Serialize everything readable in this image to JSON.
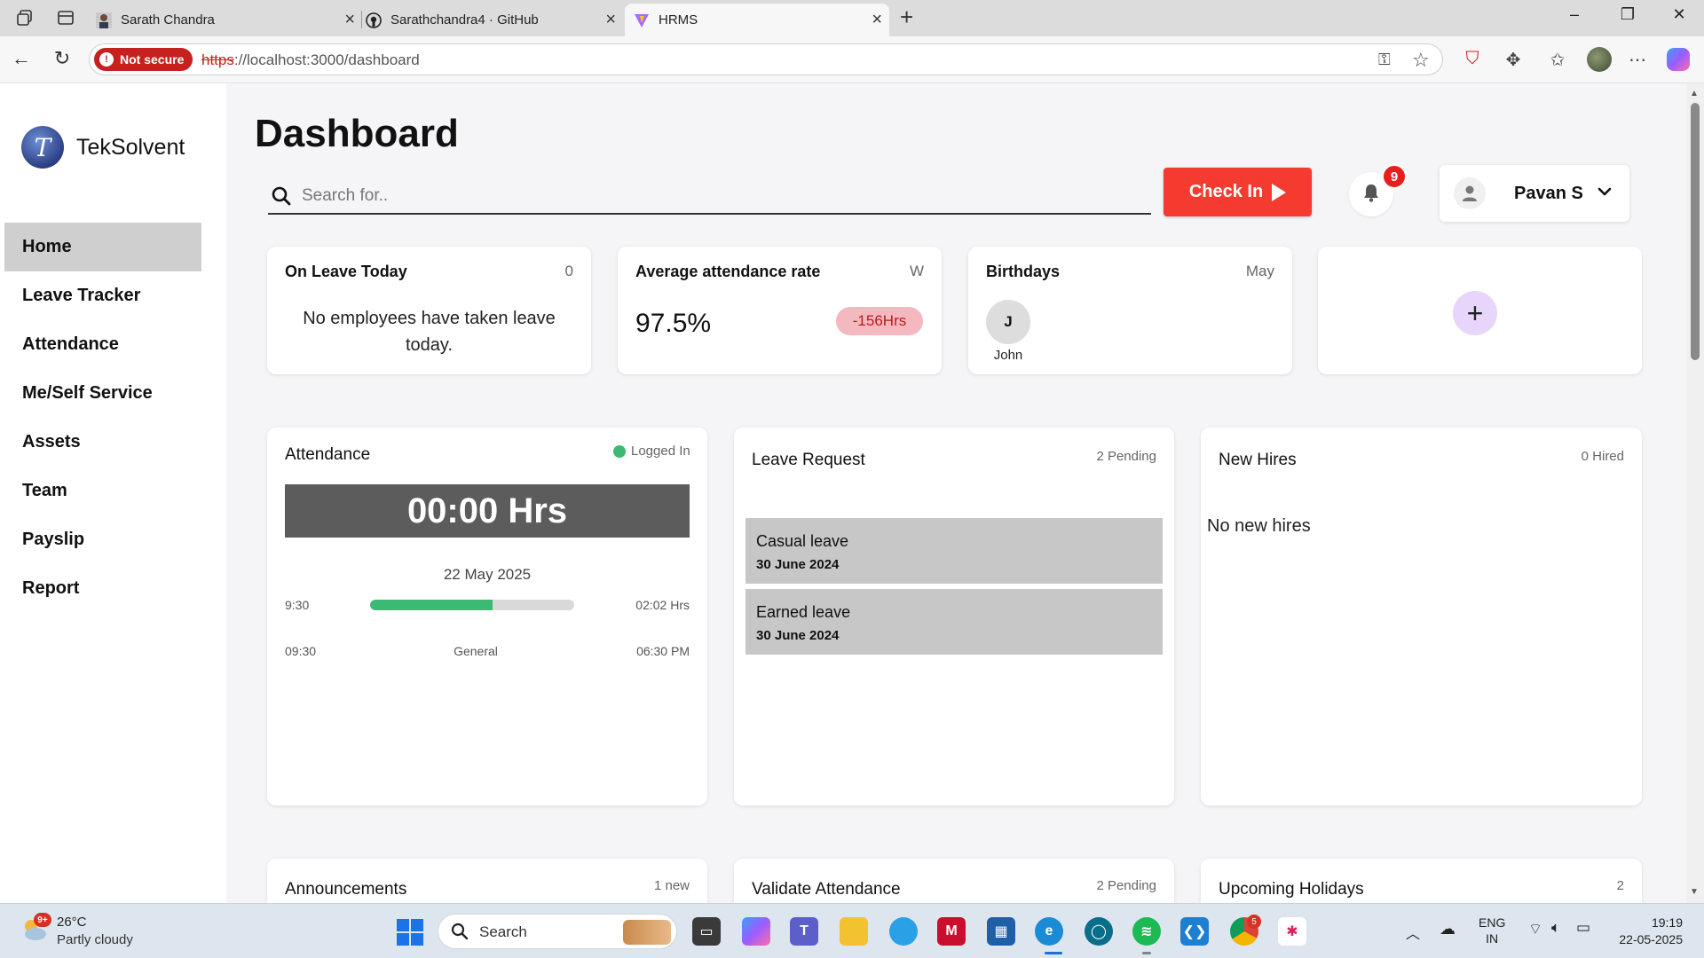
{
  "browser": {
    "tabs": [
      {
        "title": "Sarath Chandra"
      },
      {
        "title": "Sarathchandra4 · GitHub"
      },
      {
        "title": "HRMS"
      }
    ],
    "security_label": "Not secure",
    "url_scheme": "https",
    "url_rest": "://localhost:3000/dashboard"
  },
  "sidebar": {
    "brand": "TekSolvent",
    "logo_letter": "T",
    "items": [
      {
        "label": "Home"
      },
      {
        "label": "Leave Tracker"
      },
      {
        "label": "Attendance"
      },
      {
        "label": "Me/Self Service"
      },
      {
        "label": "Assets"
      },
      {
        "label": "Team"
      },
      {
        "label": "Payslip"
      },
      {
        "label": "Report"
      }
    ]
  },
  "header": {
    "title": "Dashboard",
    "search_placeholder": "Search for..",
    "checkin_label": "Check In",
    "notification_count": "9",
    "user_name": "Pavan S"
  },
  "cards": {
    "on_leave": {
      "title": "On Leave Today",
      "count": "0",
      "message": "No employees have taken leave today."
    },
    "avg_attendance": {
      "title": "Average attendance rate",
      "period": "W",
      "rate": "97.5%",
      "delta": "-156Hrs"
    },
    "birthdays": {
      "title": "Birthdays",
      "month": "May",
      "people": [
        {
          "initial": "J",
          "name": "John"
        }
      ]
    },
    "add": {
      "icon": "plus-icon"
    }
  },
  "attendance": {
    "title": "Attendance",
    "status": "Logged In",
    "timer": "00:00 Hrs",
    "date": "22 May 2025",
    "start_time": "9:30",
    "elapsed": "02:02 Hrs",
    "progress": 0.6,
    "shift_start": "09:30",
    "shift_name": "General",
    "shift_end": "06:30 PM"
  },
  "leave_request": {
    "title": "Leave Request",
    "pending": "2 Pending",
    "items": [
      {
        "type": "Casual leave",
        "date": "30 June 2024"
      },
      {
        "type": "Earned leave",
        "date": "30 June 2024"
      }
    ]
  },
  "new_hires": {
    "title": "New Hires",
    "count": "0 Hired",
    "empty": "No new hires"
  },
  "announcements": {
    "title": "Announcements",
    "count": "1 new"
  },
  "validate_attendance": {
    "title": "Validate Attendance",
    "pending": "2 Pending"
  },
  "holidays": {
    "title": "Upcoming Holidays",
    "count": "2"
  },
  "taskbar": {
    "weather_badge": "9+",
    "temperature": "26°C",
    "weather": "Partly cloudy",
    "search_label": "Search",
    "chrome_badge": "5",
    "lang_1": "ENG",
    "lang_2": "IN",
    "time": "19:19",
    "date": "22-05-2025"
  },
  "colors": {
    "accent": "#f53a2f",
    "success": "#3cba74",
    "active_menu": "#cfcfcf",
    "delta_pill": "#f4b8bf"
  }
}
